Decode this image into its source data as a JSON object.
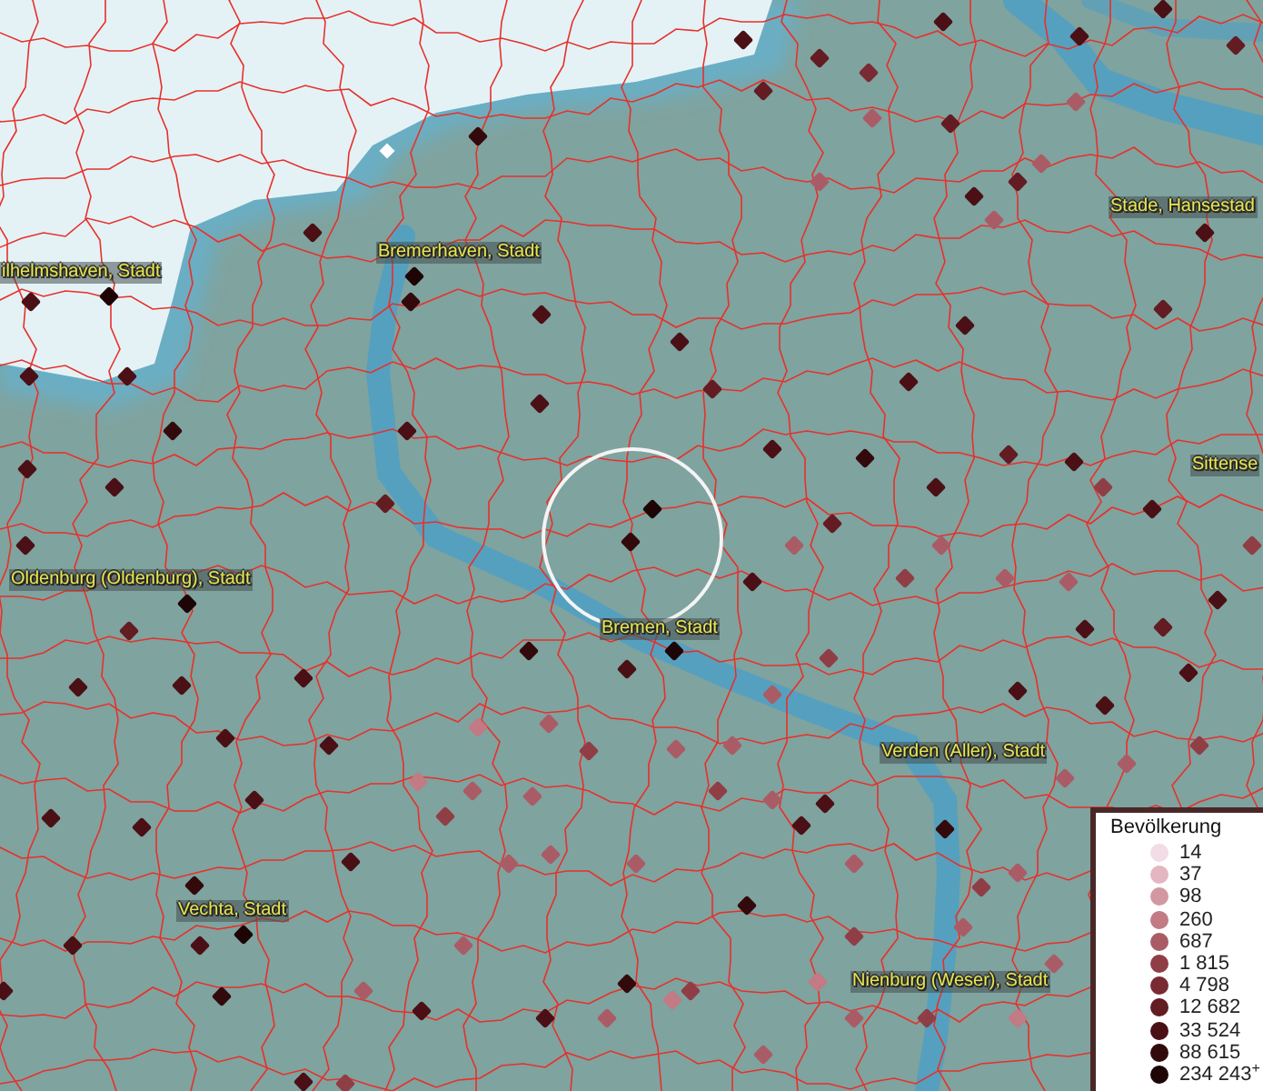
{
  "map": {
    "labels": [
      {
        "text": "ilhelmshaven, Stadt"
      },
      {
        "text": "Bremerhaven, Stadt"
      },
      {
        "text": "Stade, Hansestad"
      },
      {
        "text": "Sittense"
      },
      {
        "text": "Oldenburg (Oldenburg), Stadt"
      },
      {
        "text": "Bremen, Stadt"
      },
      {
        "text": "Verden (Aller), Stadt"
      },
      {
        "text": "Vechta, Stadt"
      },
      {
        "text": "Nienburg (Weser), Stadt"
      }
    ]
  },
  "legend": {
    "title": "Bevölkerung",
    "classes": [
      {
        "value": "14",
        "color": "#f2dce6"
      },
      {
        "value": "37",
        "color": "#e4b6c2"
      },
      {
        "value": "98",
        "color": "#d298a2"
      },
      {
        "value": "260",
        "color": "#c27a84"
      },
      {
        "value": "687",
        "color": "#aa5c66"
      },
      {
        "value": "1 815",
        "color": "#903e46"
      },
      {
        "value": "4 798",
        "color": "#7a2a32"
      },
      {
        "value": "12 682",
        "color": "#621c22"
      },
      {
        "value": "33 524",
        "color": "#4a1015"
      },
      {
        "value": "88 615",
        "color": "#330a0c"
      },
      {
        "value": "234 243$^{+}$",
        "color": "#1e0505"
      }
    ]
  }
}
